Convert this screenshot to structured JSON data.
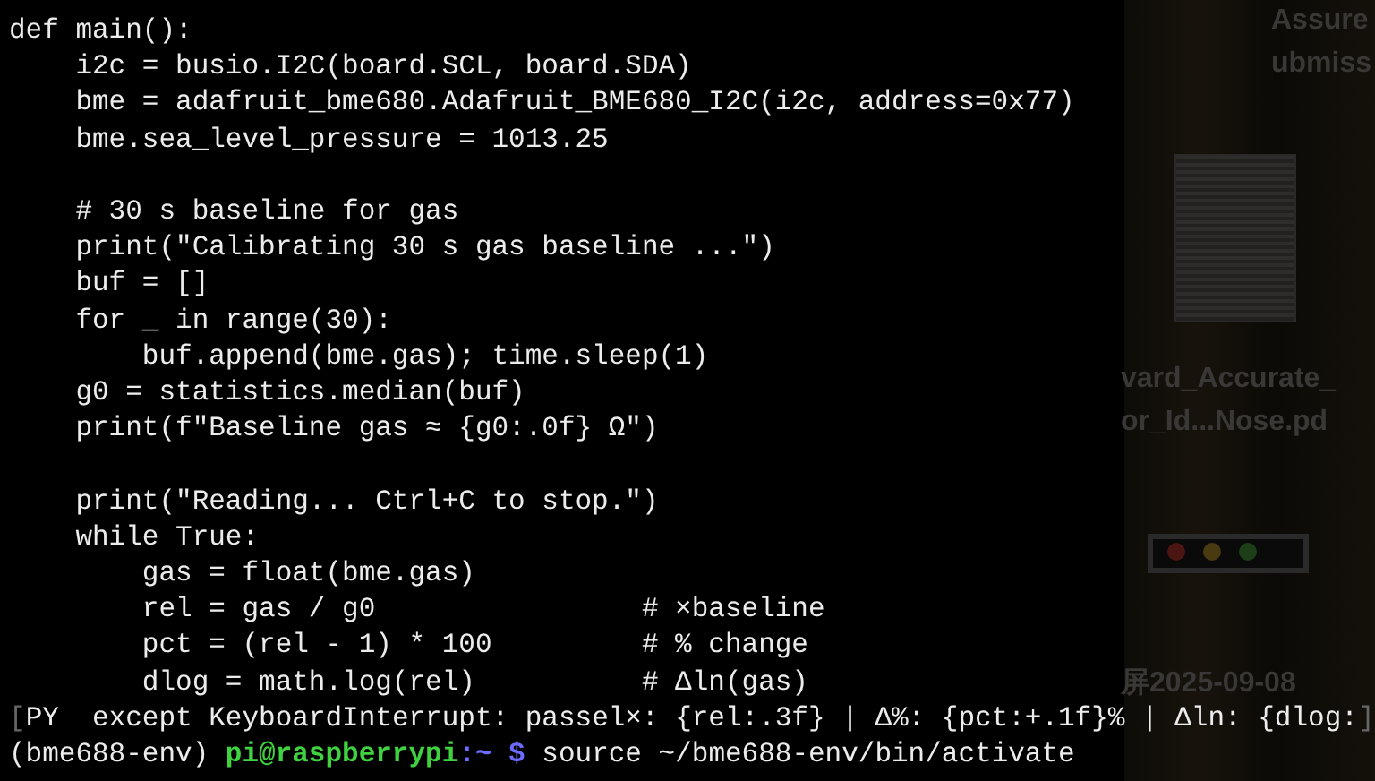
{
  "terminal": {
    "lines": [
      {
        "kind": "code",
        "segments": [
          {
            "kind": "plain",
            "text": "def main():"
          }
        ]
      },
      {
        "kind": "code",
        "segments": [
          {
            "kind": "plain",
            "text": "    i2c = busio.I2C(board.SCL, board.SDA)"
          }
        ]
      },
      {
        "kind": "code",
        "segments": [
          {
            "kind": "plain",
            "text": "    bme = adafruit_bme680.Adafruit_BME680_I2C(i2c, address=0x77)"
          }
        ]
      },
      {
        "kind": "code",
        "segments": [
          {
            "kind": "plain",
            "text": "    bme.sea_level_pressure = 1013.25"
          }
        ]
      },
      {
        "kind": "blank"
      },
      {
        "kind": "code",
        "segments": [
          {
            "kind": "plain",
            "text": "    # 30 s baseline for gas"
          }
        ]
      },
      {
        "kind": "code",
        "segments": [
          {
            "kind": "plain",
            "text": "    print(\"Calibrating 30 s gas baseline ...\")"
          }
        ]
      },
      {
        "kind": "code",
        "segments": [
          {
            "kind": "plain",
            "text": "    buf = []"
          }
        ]
      },
      {
        "kind": "code",
        "segments": [
          {
            "kind": "plain",
            "text": "    for _ in range(30):"
          }
        ]
      },
      {
        "kind": "code",
        "segments": [
          {
            "kind": "plain",
            "text": "        buf.append(bme.gas); time.sleep(1)"
          }
        ]
      },
      {
        "kind": "code",
        "segments": [
          {
            "kind": "plain",
            "text": "    g0 = statistics.median(buf)"
          }
        ]
      },
      {
        "kind": "code",
        "segments": [
          {
            "kind": "plain",
            "text": "    print(f\"Baseline gas ≈ {g0:.0f} Ω\")"
          }
        ]
      },
      {
        "kind": "blank"
      },
      {
        "kind": "code",
        "segments": [
          {
            "kind": "plain",
            "text": "    print(\"Reading... Ctrl+C to stop.\")"
          }
        ]
      },
      {
        "kind": "code",
        "segments": [
          {
            "kind": "plain",
            "text": "    while True:"
          }
        ]
      },
      {
        "kind": "code",
        "segments": [
          {
            "kind": "plain",
            "text": "        gas = float(bme.gas)"
          }
        ]
      },
      {
        "kind": "code",
        "segments": [
          {
            "kind": "plain",
            "text": "        rel = gas / g0                # ×baseline"
          }
        ]
      },
      {
        "kind": "code",
        "segments": [
          {
            "kind": "plain",
            "text": "        pct = (rel - 1) * 100         # % change"
          }
        ]
      },
      {
        "kind": "code",
        "segments": [
          {
            "kind": "plain",
            "text": "        dlog = math.log(rel)          # Δln(gas)"
          }
        ]
      },
      {
        "kind": "code",
        "segments": [
          {
            "kind": "dim",
            "text": "["
          },
          {
            "kind": "plain",
            "text": "PY  except KeyboardInterrupt: passel×: {rel:.3f} | Δ%: {pct:+.1f}% | Δln: {dlog:"
          },
          {
            "kind": "dim",
            "text": "]"
          }
        ]
      },
      {
        "kind": "code",
        "segments": [
          {
            "kind": "plain",
            "text": "(bme688-env) "
          },
          {
            "kind": "user",
            "text": "pi@raspberrypi"
          },
          {
            "kind": "path",
            "text": ":~ $"
          },
          {
            "kind": "plain",
            "text": " source ~/bme688-env/bin/activate"
          }
        ]
      }
    ]
  },
  "desktop": {
    "items": [
      {
        "kind": "label",
        "lines": [
          "Assure",
          "ubmiss"
        ]
      },
      {
        "kind": "document"
      },
      {
        "kind": "label",
        "lines": [
          "vard_Accurate_",
          "or_Id...Nose.pd"
        ]
      },
      {
        "kind": "window"
      },
      {
        "kind": "label",
        "lines": [
          "屏2025-09-08"
        ]
      }
    ]
  }
}
